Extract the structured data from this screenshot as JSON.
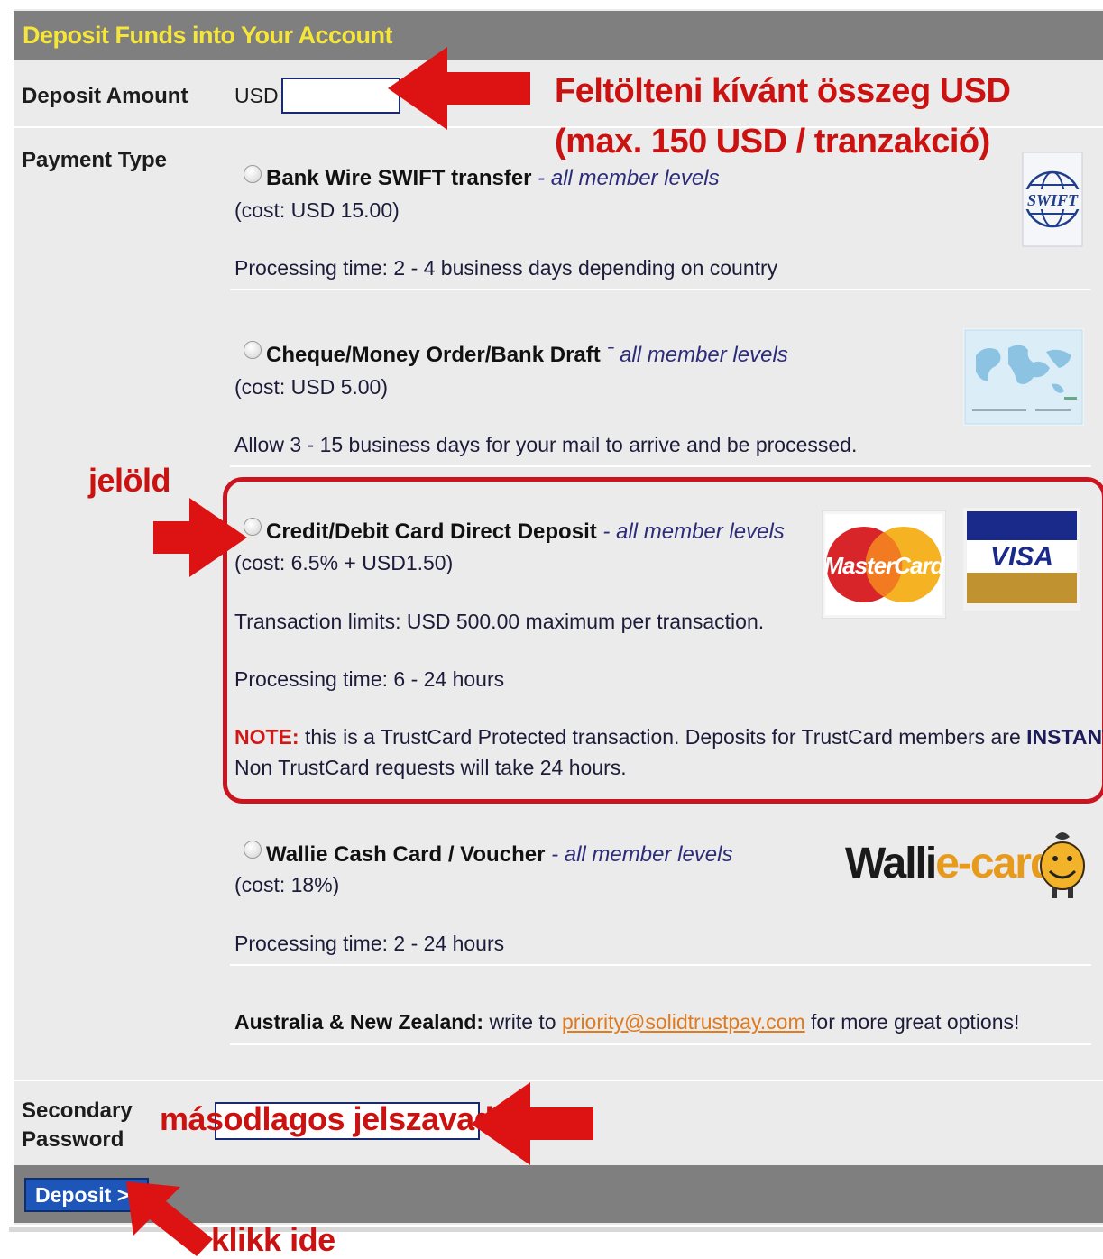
{
  "header": {
    "title": "Deposit Funds into Your Account"
  },
  "deposit_amount": {
    "label": "Deposit Amount",
    "currency": "USD",
    "value": ""
  },
  "payment_type": {
    "label": "Payment Type",
    "options": [
      {
        "title": "Bank Wire SWIFT transfer",
        "sep": " - ",
        "levels": "all member levels",
        "cost": "(cost: USD 15.00)",
        "lines": [
          "Processing time: 2 - 4 business days depending on country"
        ],
        "logo": "swift-logo",
        "logo_text": "SWIFT"
      },
      {
        "title": "Cheque/Money Order/Bank Draft",
        "sep": " ˉ ",
        "levels": "all member levels",
        "cost": "(cost: USD 5.00)",
        "lines": [
          "Allow 3 - 15 business days for your mail to arrive and be processed."
        ],
        "logo": "cheque-world-map-image"
      },
      {
        "title": "Credit/Debit Card Direct Deposit",
        "sep": " - ",
        "levels": "all member levels",
        "cost": "(cost: 6.5% + USD1.50)",
        "lines": [
          "Transaction limits: USD 500.00 maximum per transaction.",
          "Processing time: 6 - 24 hours"
        ],
        "note_label": "NOTE:",
        "note_text_1": " this is a TrustCard Protected transaction. Deposits for TrustCard members are ",
        "note_emph": "INSTANT.",
        "note_text_2": "Non TrustCard requests will take 24 hours.",
        "mastercard_text": "MasterCard",
        "visa_text": "VISA"
      },
      {
        "title": "Wallie Cash Card / Voucher",
        "sep": " - ",
        "levels": "all member levels",
        "cost": "(cost: 18%)",
        "lines": [
          "Processing time: 2 - 24 hours"
        ],
        "logo_text_1": "Walli",
        "logo_text_2": "e-card"
      }
    ],
    "anz": {
      "label": "Australia & New Zealand:",
      "pre": " write to ",
      "email": "priority@solidtrustpay.com",
      "post": " for more great options!"
    }
  },
  "secondary_password": {
    "label_1": "Secondary",
    "label_2": "Password",
    "value": ""
  },
  "submit": {
    "label": "Deposit >>"
  },
  "annotations": {
    "amount_1": "Feltölteni kívánt összeg USD",
    "amount_2": "(max. 150 USD / tranzakció)",
    "select": "jelöld",
    "password": "másodlagos jelszavad",
    "click": "klikk ide"
  },
  "colors": {
    "annotation": "#cc1111",
    "title": "#f5e63c",
    "header_bg": "#7f7f7f"
  }
}
